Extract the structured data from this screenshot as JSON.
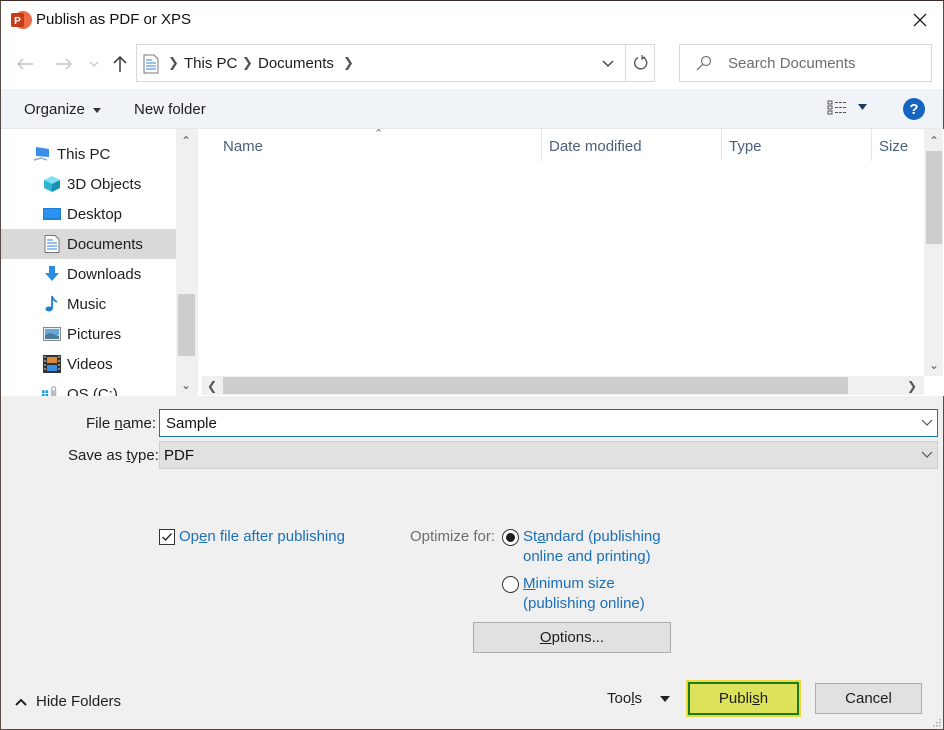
{
  "window": {
    "title": "Publish as PDF or XPS",
    "app_icon": "powerpoint-icon",
    "brand_color": "#d04423"
  },
  "nav": {
    "back_icon": "arrow-left-icon",
    "forward_icon": "arrow-right-icon",
    "recent_icon": "chevron-down-icon",
    "up_icon": "arrow-up-icon",
    "breadcrumb": [
      "This PC",
      "Documents"
    ],
    "refresh_icon": "refresh-icon",
    "search_placeholder": "Search Documents"
  },
  "toolbar": {
    "organize_label": "Organize",
    "new_folder_label": "New folder",
    "help_label": "?"
  },
  "sidebar": {
    "items": [
      {
        "label": "This PC",
        "icon": "computer-icon"
      },
      {
        "label": "3D Objects",
        "icon": "cube-icon"
      },
      {
        "label": "Desktop",
        "icon": "desktop-icon"
      },
      {
        "label": "Documents",
        "icon": "document-icon",
        "selected": true
      },
      {
        "label": "Downloads",
        "icon": "download-icon"
      },
      {
        "label": "Music",
        "icon": "music-icon"
      },
      {
        "label": "Pictures",
        "icon": "pictures-icon"
      },
      {
        "label": "Videos",
        "icon": "videos-icon"
      },
      {
        "label": "OS (C:)",
        "icon": "drive-icon"
      }
    ]
  },
  "filelist": {
    "columns": [
      "Name",
      "Date modified",
      "Type",
      "Size"
    ],
    "rows": []
  },
  "form": {
    "file_name_label_pre": "File ",
    "file_name_label_u": "n",
    "file_name_label_post": "ame:",
    "file_name_value": "Sample",
    "save_type_label_pre": "Save as ",
    "save_type_label_u": "t",
    "save_type_label_post": "ype:",
    "save_type_value": "PDF"
  },
  "options": {
    "open_after_pre": "Op",
    "open_after_u": "e",
    "open_after_post": "n file after publishing",
    "open_after_checked": true,
    "optimize_label": "Optimize for:",
    "standard_line1_pre": "St",
    "standard_line1_u": "a",
    "standard_line1_post": "ndard (publishing",
    "standard_line2": "online and printing)",
    "standard_selected": true,
    "minimum_line1_u": "M",
    "minimum_line1_post": "inimum size",
    "minimum_line2": "(publishing online)",
    "options_button_u": "O",
    "options_button_post": "ptions..."
  },
  "footer": {
    "hide_folders_label": "Hide Folders",
    "tools_pre": "Too",
    "tools_u": "l",
    "tools_post": "s",
    "publish_pre": "Publi",
    "publish_u": "s",
    "publish_post": "h",
    "cancel_label": "Cancel"
  }
}
